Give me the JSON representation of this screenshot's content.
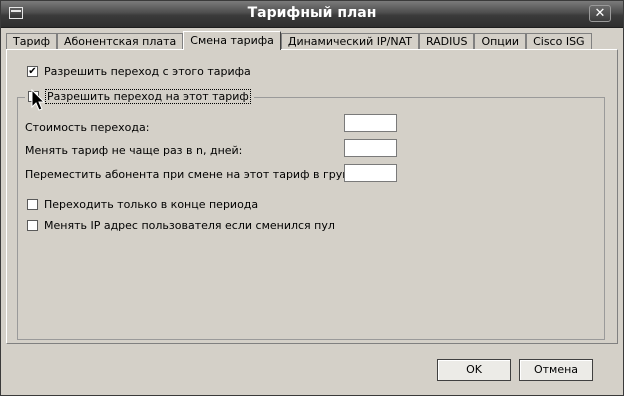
{
  "window": {
    "title": "Тарифный план",
    "close_glyph": "✕",
    "icon": "window-menu-icon"
  },
  "tabs": [
    {
      "label": "Тариф"
    },
    {
      "label": "Абонентская плата"
    },
    {
      "label": "Смена тарифа"
    },
    {
      "label": "Динамический IP/NAT"
    },
    {
      "label": "RADIUS"
    },
    {
      "label": "Опции"
    },
    {
      "label": "Cisco ISG"
    }
  ],
  "active_tab": "Смена тарифа",
  "allow_from": {
    "label": "Разрешить переход с этого тарифа",
    "checked": true,
    "mark": "✔"
  },
  "allow_to": {
    "label": "Разрешить переход на этот тариф",
    "checked": false
  },
  "fields": {
    "cost": {
      "label": "Стоимость перехода:",
      "value": ""
    },
    "interval": {
      "label": "Менять тариф не чаще раз в n, дней:",
      "value": ""
    },
    "group": {
      "label": "Переместить абонента при смене на этот тариф в группу ID=",
      "value": ""
    }
  },
  "end_of_period": {
    "label": "Переходить только в конце периода",
    "checked": false
  },
  "change_ip": {
    "label": "Менять IP адрес пользователя если сменился пул",
    "checked": false
  },
  "buttons": {
    "ok": "OK",
    "cancel": "Отмена"
  }
}
